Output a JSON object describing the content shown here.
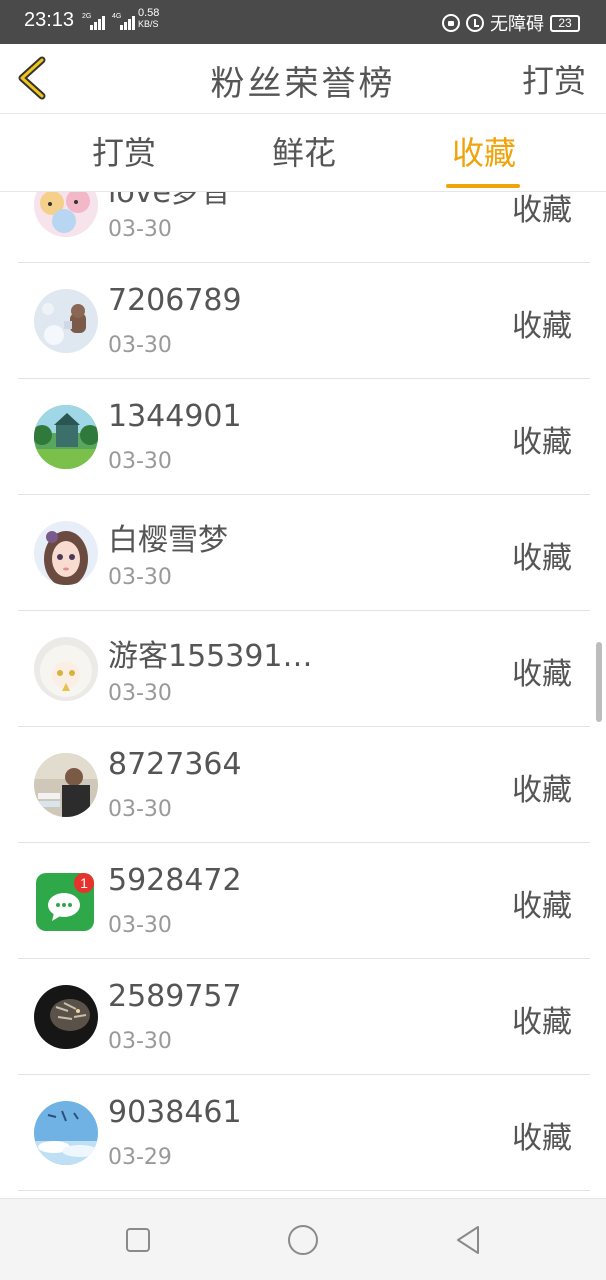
{
  "status_bar": {
    "time": "23:13",
    "network_speed": "0.58",
    "network_unit": "KB/S",
    "sim1_label": "2G",
    "sim2_label": "4G",
    "accessibility": "无障碍",
    "battery": "23",
    "icons": [
      "lock-icon",
      "alarm-icon"
    ]
  },
  "header": {
    "title": "粉丝荣誉榜",
    "action_label": "打赏",
    "back_icon": "chevron-left-icon",
    "accent_color": "#f0a30a"
  },
  "tabs": [
    {
      "label": "打赏",
      "active": false
    },
    {
      "label": "鲜花",
      "active": false
    },
    {
      "label": "收藏",
      "active": true
    }
  ],
  "list": {
    "rows": [
      {
        "name": "love梦音",
        "date": "03-30",
        "action": "收藏",
        "avatar": "anime-girls-avatar"
      },
      {
        "name": "7206789",
        "date": "03-30",
        "action": "收藏",
        "avatar": "teddy-bear-avatar"
      },
      {
        "name": "1344901",
        "date": "03-30",
        "action": "收藏",
        "avatar": "house-landscape-avatar"
      },
      {
        "name": "白樱雪梦",
        "date": "03-30",
        "action": "收藏",
        "avatar": "doll-girl-avatar"
      },
      {
        "name": "游客155391…",
        "date": "03-30",
        "action": "收藏",
        "avatar": "white-hair-girl-avatar"
      },
      {
        "name": "8727364",
        "date": "03-30",
        "action": "收藏",
        "avatar": "office-man-avatar"
      },
      {
        "name": "5928472",
        "date": "03-30",
        "action": "收藏",
        "avatar": "wechat-app-avatar",
        "badge": "1"
      },
      {
        "name": "2589757",
        "date": "03-30",
        "action": "收藏",
        "avatar": "tiger-avatar"
      },
      {
        "name": "9038461",
        "date": "03-29",
        "action": "收藏",
        "avatar": "blue-sky-avatar"
      }
    ]
  },
  "navbar": {
    "icons": [
      "recent-apps-icon",
      "home-icon",
      "back-triangle-icon"
    ]
  }
}
